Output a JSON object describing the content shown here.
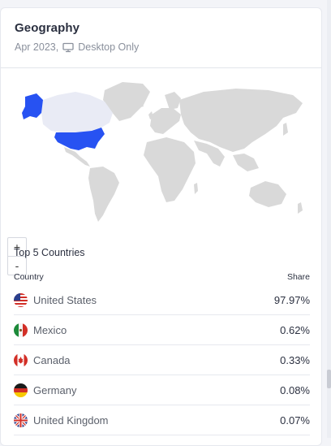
{
  "widget": {
    "title": "Geography",
    "date": "Apr 2023,",
    "device_icon": "monitor-icon",
    "device_label": "Desktop Only"
  },
  "map": {
    "highlight_color": "#2752f2",
    "land_color": "#d9d9d9",
    "zoom_in_label": "+",
    "zoom_out_label": "-"
  },
  "top_countries": {
    "heading": "Top 5 Countries",
    "col_country": "Country",
    "col_share": "Share",
    "rows": [
      {
        "country": "United States",
        "share": "97.97%",
        "flag": "us-flag-icon"
      },
      {
        "country": "Mexico",
        "share": "0.62%",
        "flag": "mx-flag-icon"
      },
      {
        "country": "Canada",
        "share": "0.33%",
        "flag": "ca-flag-icon"
      },
      {
        "country": "Germany",
        "share": "0.08%",
        "flag": "de-flag-icon"
      },
      {
        "country": "United Kingdom",
        "share": "0.07%",
        "flag": "uk-flag-icon"
      }
    ]
  }
}
